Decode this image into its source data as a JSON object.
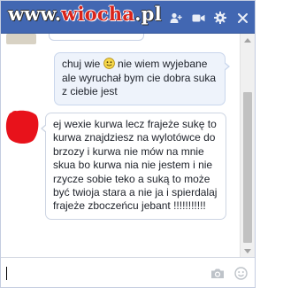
{
  "header": {
    "watermark_left": "www.",
    "watermark_mid": "wiocha",
    "watermark_right": ".pl",
    "background_color": "#4267b2",
    "icons": [
      "add-friend-icon",
      "video-call-icon",
      "gear-icon",
      "close-icon"
    ]
  },
  "messages": [
    {
      "direction": "outgoing",
      "text_before_emoji": "chuj wie ",
      "emoji": "smiley-icon",
      "text_after_emoji": " nie wiem wyjebane ale wyruchał bym cie dobra suka z ciebie jest"
    },
    {
      "direction": "incoming",
      "avatar": "censored-avatar",
      "text": "ej wexie kurwa lecz frajeże sukę to kurwa znajdziesz na wylotówce do brzozy i kurwa nie mów na mnie skua bo kurwa nia nie jestem i nie rzycze sobie teko a suką to może być twioja stara a nie ja i spierdalaj frajeże zboczeńcu jebant !!!!!!!!!!!"
    }
  ],
  "composer": {
    "value": "",
    "icons": [
      "camera-icon",
      "emoji-icon"
    ]
  },
  "colors": {
    "outgoing_bubble": "#eef3fb",
    "incoming_bubble": "#ffffff",
    "censor": "#e8121b"
  }
}
